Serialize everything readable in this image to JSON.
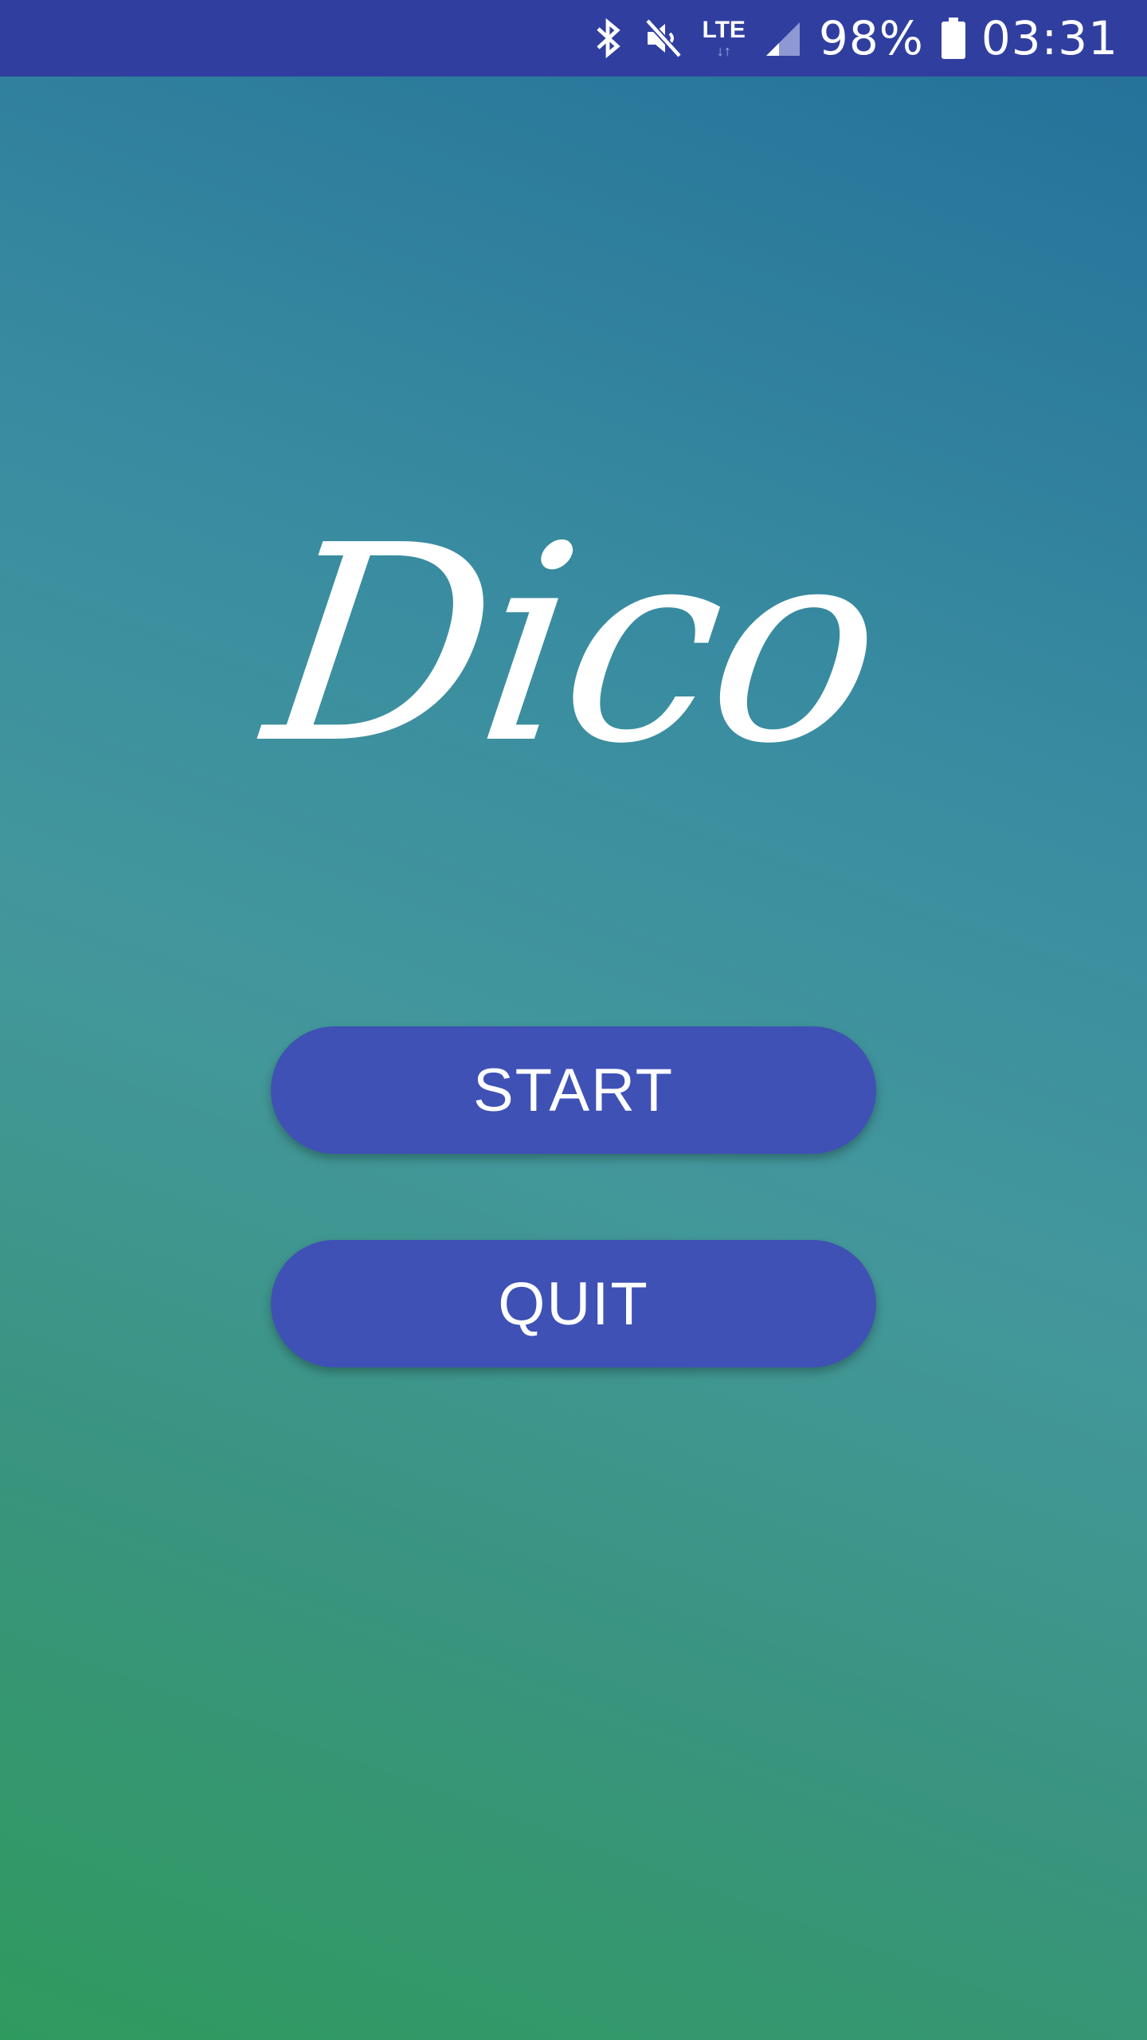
{
  "status_bar": {
    "network_label": "LTE",
    "battery_percent": "98%",
    "time": "03:31",
    "icons": [
      "bluetooth-icon",
      "mute-icon",
      "lte-icon",
      "signal-icon",
      "battery-icon"
    ]
  },
  "app": {
    "logo_text": "Dico"
  },
  "buttons": {
    "start_label": "START",
    "quit_label": "QUIT"
  },
  "colors": {
    "status_bar": "#303f9f",
    "button": "#3f51b5",
    "gradient_top": "#236f9a",
    "gradient_bottom": "#2f9a5e"
  }
}
